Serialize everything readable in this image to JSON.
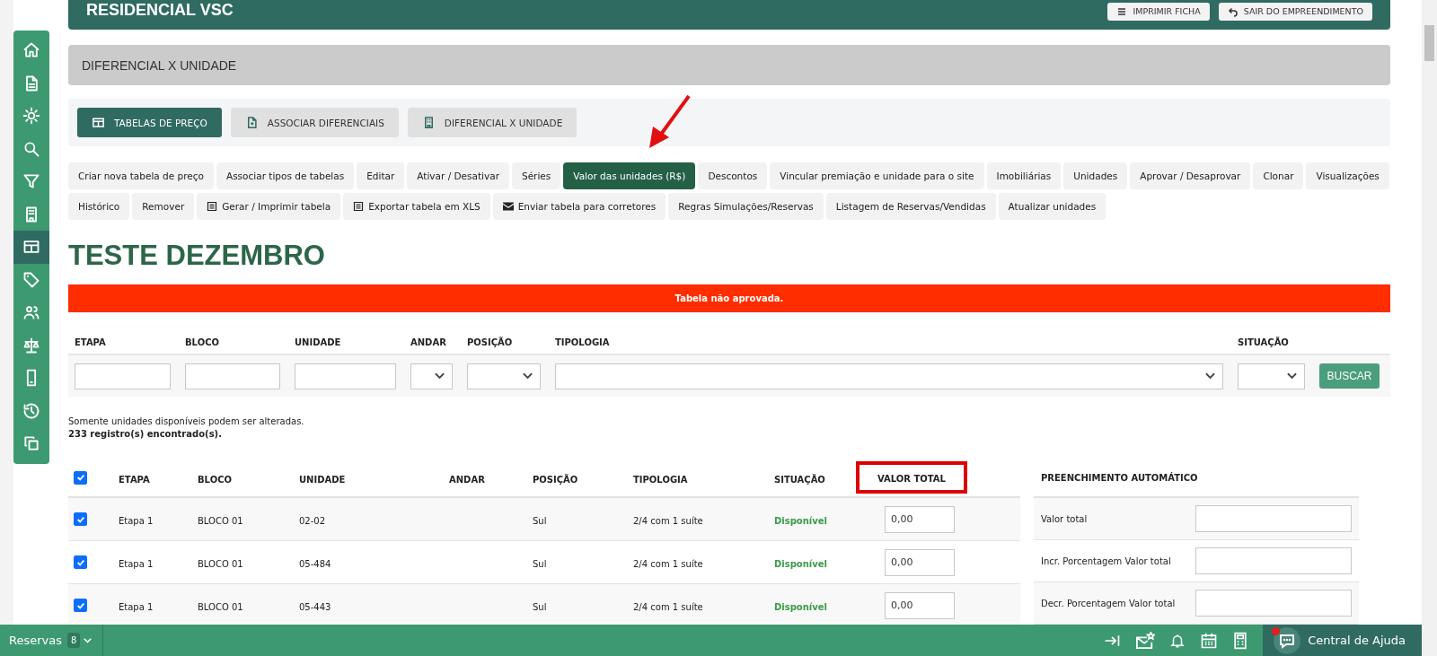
{
  "sidebar": {
    "items": [
      {
        "selected": false
      },
      {
        "selected": false
      },
      {
        "selected": false
      },
      {
        "selected": false
      },
      {
        "selected": false
      },
      {
        "selected": false
      },
      {
        "selected": true
      },
      {
        "selected": false
      },
      {
        "selected": false
      },
      {
        "selected": false
      },
      {
        "selected": false
      },
      {
        "selected": false
      },
      {
        "selected": false
      }
    ]
  },
  "header": {
    "title": "RESIDENCIAL VSC",
    "buttons": [
      "IMPRIMIR FICHA",
      "SAIR DO EMPREENDIMENTO"
    ]
  },
  "section_title": "DIFERENCIAL X UNIDADE",
  "nav_tabs": [
    {
      "label": "TABELAS DE PREÇO",
      "selected": true
    },
    {
      "label": "ASSOCIAR DIFERENCIAIS",
      "selected": false
    },
    {
      "label": "DIFERENCIAL X UNIDADE",
      "selected": false
    }
  ],
  "actions": [
    {
      "label": "Criar nova tabela de preço",
      "kind": "plain",
      "selected": false
    },
    {
      "label": "Associar tipos de tabelas",
      "kind": "plain",
      "selected": false
    },
    {
      "label": "Editar",
      "kind": "plain",
      "selected": false
    },
    {
      "label": "Ativar / Desativar",
      "kind": "plain",
      "selected": false
    },
    {
      "label": "Séries",
      "kind": "plain",
      "selected": false
    },
    {
      "label": "Valor das unidades (R$)",
      "kind": "plain",
      "selected": true
    },
    {
      "label": "Descontos",
      "kind": "plain",
      "selected": false
    },
    {
      "label": "Vincular premiação e unidade para o site",
      "kind": "plain",
      "selected": false
    },
    {
      "label": "Imobiliárias",
      "kind": "plain",
      "selected": false
    },
    {
      "label": "Unidades",
      "kind": "plain",
      "selected": false
    },
    {
      "label": "Aprovar / Desaprovar",
      "kind": "plain",
      "selected": false
    },
    {
      "label": "Clonar",
      "kind": "plain",
      "selected": false
    },
    {
      "label": "Visualizações",
      "kind": "plain",
      "selected": false
    },
    {
      "label": "Histórico",
      "kind": "plain",
      "selected": false
    },
    {
      "label": "Remover",
      "kind": "plain",
      "selected": false
    },
    {
      "label": "Gerar / Imprimir tabela",
      "kind": "sheet",
      "selected": false
    },
    {
      "label": "Exportar tabela em XLS",
      "kind": "sheet",
      "selected": false
    },
    {
      "label": "Enviar tabela para corretores",
      "kind": "mail",
      "selected": false
    },
    {
      "label": "Regras Simulações/Reservas",
      "kind": "plain",
      "selected": false
    },
    {
      "label": "Listagem de Reservas/Vendidas",
      "kind": "plain",
      "selected": false
    },
    {
      "label": "Atualizar unidades",
      "kind": "plain",
      "selected": false
    }
  ],
  "page_title": "TESTE DEZEMBRO",
  "alert": "Tabela não aprovada.",
  "filters": {
    "fields": [
      {
        "label": "ETAPA",
        "kind": "text"
      },
      {
        "label": "BLOCO",
        "kind": "text"
      },
      {
        "label": "UNIDADE",
        "kind": "text"
      },
      {
        "label": "ANDAR",
        "kind": "select"
      },
      {
        "label": "POSIÇÃO",
        "kind": "select"
      },
      {
        "label": "TIPOLOGIA",
        "kind": "select"
      },
      {
        "label": "SITUAÇÃO",
        "kind": "select"
      }
    ],
    "button": "BUSCAR"
  },
  "info": "Somente unidades disponíveis podem ser alteradas.",
  "count": "233 registro(s) encontrado(s).",
  "table": {
    "select_all_checked": true,
    "columns": [
      {
        "label": "ETAPA",
        "highlighted": false
      },
      {
        "label": "BLOCO",
        "highlighted": false
      },
      {
        "label": "UNIDADE",
        "highlighted": false
      },
      {
        "label": "ANDAR",
        "highlighted": false
      },
      {
        "label": "POSIÇÃO",
        "highlighted": false
      },
      {
        "label": "TIPOLOGIA",
        "highlighted": false
      },
      {
        "label": "SITUAÇÃO",
        "highlighted": false
      },
      {
        "label": "VALOR TOTAL",
        "highlighted": true
      }
    ],
    "rows": [
      {
        "checked": true,
        "etapa": "Etapa 1",
        "bloco": "BLOCO 01",
        "unidade": "02-02",
        "posicao": "Sul",
        "tipologia": "2/4 com 1 suíte",
        "situacao": "Disponível",
        "valor": "0,00"
      },
      {
        "checked": true,
        "etapa": "Etapa 1",
        "bloco": "BLOCO 01",
        "unidade": "05-484",
        "posicao": "Sul",
        "tipologia": "2/4 com 1 suíte",
        "situacao": "Disponível",
        "valor": "0,00"
      },
      {
        "checked": true,
        "etapa": "Etapa 1",
        "bloco": "BLOCO 01",
        "unidade": "05-443",
        "posicao": "Sul",
        "tipologia": "2/4 com 1 suíte",
        "situacao": "Disponível",
        "valor": "0,00"
      }
    ]
  },
  "auto_fill": {
    "title": "PREENCHIMENTO AUTOMÁTICO",
    "rows": [
      "Valor total",
      "Incr. Porcentagem Valor total",
      "Decr. Porcentagem Valor total"
    ]
  },
  "bottom_bar": {
    "reservas": "Reservas",
    "reservas_count": "8",
    "help": "Central de Ajuda",
    "help_notification": true
  }
}
